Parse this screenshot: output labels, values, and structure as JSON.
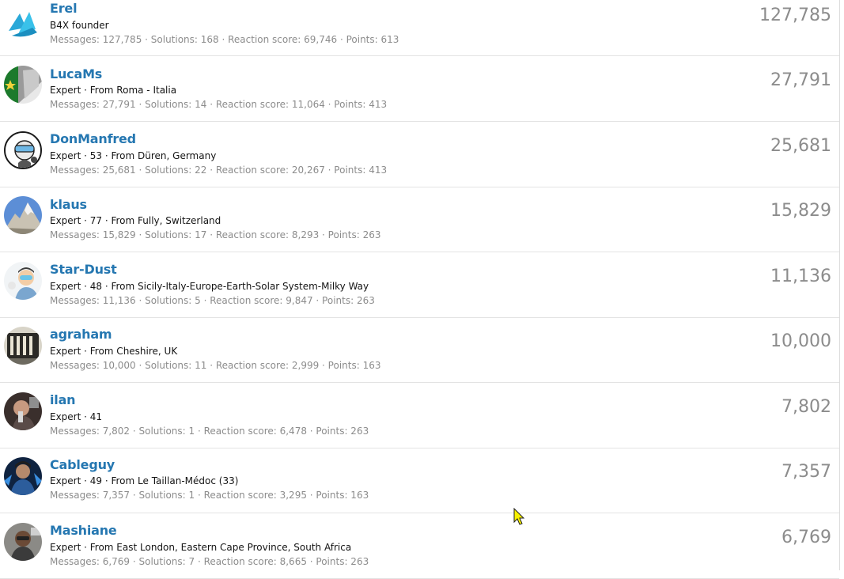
{
  "members": [
    {
      "name": "Erel",
      "blurb": "B4X founder",
      "stats": "Messages: 127,785 · Solutions: 168 · Reaction score: 69,746 · Points: 613",
      "count": "127,785",
      "avatar": "b4x-logo-icon"
    },
    {
      "name": "LucaMs",
      "blurb": "Expert · From Roma - Italia",
      "stats": "Messages: 27,791 · Solutions: 14 · Reaction score: 11,064 · Points: 413",
      "count": "27,791",
      "avatar": "flag-avatar"
    },
    {
      "name": "DonManfred",
      "blurb": "Expert · 53 · From Düren, Germany",
      "stats": "Messages: 25,681 · Solutions: 22 · Reaction score: 20,267 · Points: 413",
      "count": "25,681",
      "avatar": "cartoon-avatar"
    },
    {
      "name": "klaus",
      "blurb": "Expert · 77 · From Fully, Switzerland",
      "stats": "Messages: 15,829 · Solutions: 17 · Reaction score: 8,293 · Points: 263",
      "count": "15,829",
      "avatar": "mountain-avatar"
    },
    {
      "name": "Star-Dust",
      "blurb": "Expert · 48 · From Sicily-Italy-Europe-Earth-Solar System-Milky Way",
      "stats": "Messages: 11,136 · Solutions: 5 · Reaction score: 9,847 · Points: 263",
      "count": "11,136",
      "avatar": "cartoon-avatar"
    },
    {
      "name": "agraham",
      "blurb": "Expert · From Cheshire, UK",
      "stats": "Messages: 10,000 · Solutions: 11 · Reaction score: 2,999 · Points: 163",
      "count": "10,000",
      "avatar": "building-avatar"
    },
    {
      "name": "ilan",
      "blurb": "Expert · 41",
      "stats": "Messages: 7,802 · Solutions: 1 · Reaction score: 6,478 · Points: 263",
      "count": "7,802",
      "avatar": "photo-avatar"
    },
    {
      "name": "Cableguy",
      "blurb": "Expert · 49 · From Le Taillan-Médoc (33)",
      "stats": "Messages: 7,357 · Solutions: 1 · Reaction score: 3,295 · Points: 163",
      "count": "7,357",
      "avatar": "photo-avatar"
    },
    {
      "name": "Mashiane",
      "blurb": "Expert · From East London, Eastern Cape Province, South Africa",
      "stats": "Messages: 6,769 · Solutions: 7 · Reaction score: 8,665 · Points: 263",
      "count": "6,769",
      "avatar": "photo-avatar"
    }
  ],
  "colors": {
    "link": "#2577b1",
    "muted": "#8c8c8c",
    "text": "#141414",
    "divider": "#e3e3e3"
  }
}
